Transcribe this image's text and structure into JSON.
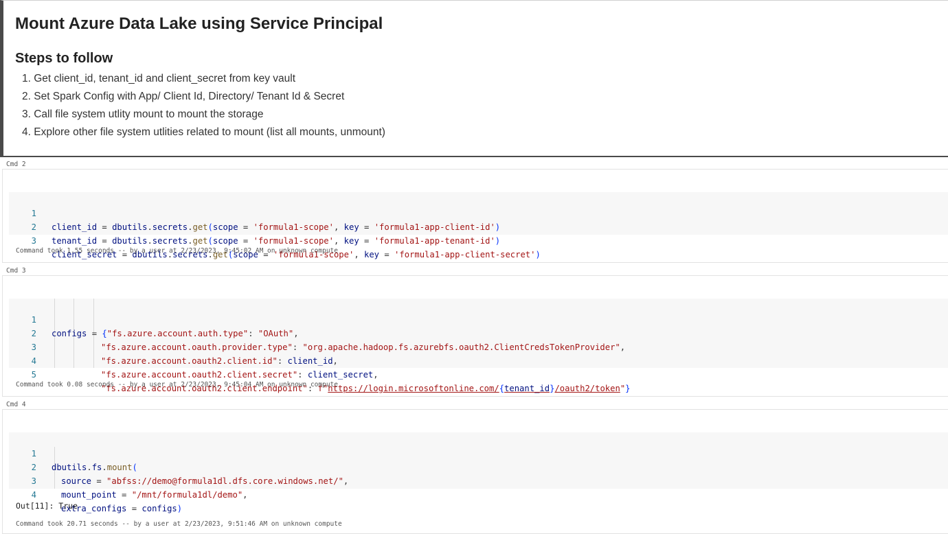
{
  "markdown": {
    "title": "Mount Azure Data Lake using Service Principal",
    "subtitle": "Steps to follow",
    "steps": [
      "1. Get client_id, tenant_id and client_secret from key vault",
      "2. Set Spark Config with App/ Client Id, Directory/ Tenant Id & Secret",
      "3. Call file system utlity mount to mount the storage",
      "4. Explore other file system utlities related to mount (list all mounts, unmount)"
    ]
  },
  "cells": [
    {
      "label": "Cmd 2",
      "line_numbers": [
        "1",
        "2",
        "3"
      ],
      "status": "Command took 1.55 seconds -- by a user at 2/23/2023, 9:45:02 AM on unknown compute"
    },
    {
      "label": "Cmd 3",
      "line_numbers": [
        "1",
        "2",
        "3",
        "4",
        "5"
      ],
      "status": "Command took 0.08 seconds -- by a user at 2/23/2023, 9:45:04 AM on unknown compute"
    },
    {
      "label": "Cmd 4",
      "line_numbers": [
        "1",
        "2",
        "3",
        "4"
      ],
      "output": "Out[11]: True",
      "status": "Command took 20.71 seconds -- by a user at 2/23/2023, 9:51:46 AM on unknown compute"
    }
  ],
  "code": {
    "c2": {
      "l1": [
        "client_id",
        " = ",
        "dbutils",
        ".",
        "secrets",
        ".",
        "get",
        "(",
        "scope",
        " = ",
        "'formula1-scope'",
        ", ",
        "key",
        " = ",
        "'formula1-app-client-id'",
        ")"
      ],
      "l2": [
        "tenant_id",
        " = ",
        "dbutils",
        ".",
        "secrets",
        ".",
        "get",
        "(",
        "scope",
        " = ",
        "'formula1-scope'",
        ", ",
        "key",
        " = ",
        "'formula1-app-tenant-id'",
        ")"
      ],
      "l3": [
        "client_secret",
        " = ",
        "dbutils",
        ".",
        "secrets",
        ".",
        "get",
        "(",
        "scope",
        " = ",
        "'formula1-scope'",
        ", ",
        "key",
        " = ",
        "'formula1-app-client-secret'",
        ")"
      ]
    },
    "c3": {
      "l1": [
        "configs",
        " = ",
        "{",
        "\"fs.azure.account.auth.type\"",
        ": ",
        "\"OAuth\"",
        ","
      ],
      "l2": [
        "\"fs.azure.account.oauth.provider.type\"",
        ": ",
        "\"org.apache.hadoop.fs.azurebfs.oauth2.ClientCredsTokenProvider\"",
        ","
      ],
      "l3": [
        "\"fs.azure.account.oauth2.client.id\"",
        ": ",
        "client_id",
        ","
      ],
      "l4": [
        "\"fs.azure.account.oauth2.client.secret\"",
        ": ",
        "client_secret",
        ","
      ],
      "l5": [
        "\"fs.azure.account.oauth2.client.endpoint\"",
        ": ",
        "f\"",
        "https://login.microsoftonline.com/",
        "{",
        "tenant_id",
        "}",
        "/oauth2/token",
        "\"",
        "}"
      ]
    },
    "c4": {
      "l1": [
        "dbutils",
        ".",
        "fs",
        ".",
        "mount",
        "("
      ],
      "l2": [
        "source",
        " = ",
        "\"abfss://demo@formula1dl.dfs.core.windows.net/\"",
        ","
      ],
      "l3": [
        "mount_point",
        " = ",
        "\"/mnt/formula1dl/demo\"",
        ","
      ],
      "l4": [
        "extra_configs",
        " = ",
        "configs",
        ")"
      ]
    }
  },
  "colors": {
    "string": "#a31515",
    "variable": "#001080",
    "function": "#795e26",
    "bracket": "#0431fa",
    "line_number": "#237893",
    "code_background": "#f7f7f7",
    "markdown_border": "#4a4a4a"
  }
}
